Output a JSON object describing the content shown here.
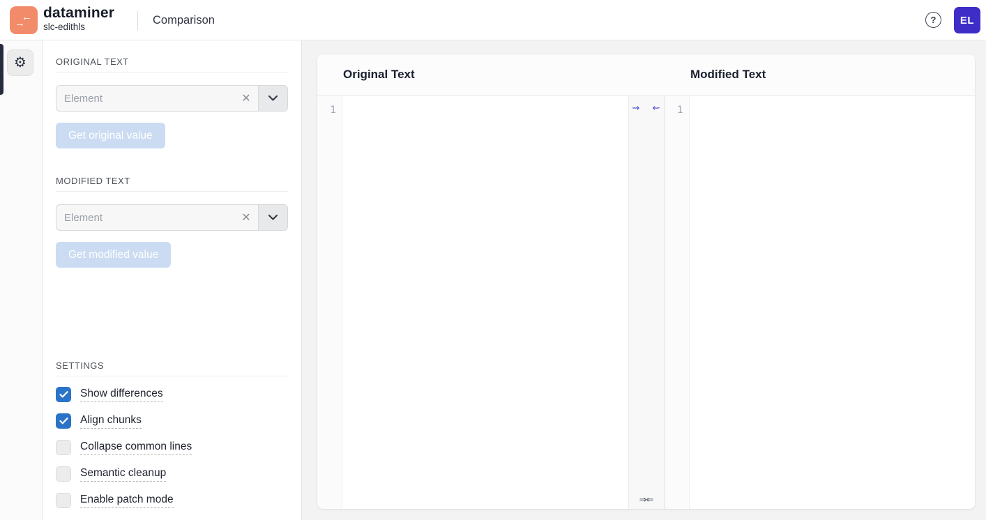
{
  "header": {
    "app_name": "dataminer",
    "app_subtitle": "slc-edithls",
    "page_title": "Comparison",
    "help_label": "?",
    "user_initials": "EL"
  },
  "icons": {
    "logo_arrow_right": "→",
    "logo_arrow_left": "←",
    "gear": "⚙",
    "clear": "✕",
    "copy_right_wavy": "⇝",
    "copy_left_wavy": "⇜",
    "align_arrows": "⇒⇐"
  },
  "colors": {
    "logo_bg": "#F28B69",
    "avatar_bg": "#3F2DC8",
    "checkbox_checked": "#2B73C8",
    "disabled_button_bg": "#CBDCF2",
    "merge_arrow": "#5251CF",
    "page_bg": "#F3F3F4"
  },
  "sidebar": {
    "original_section": {
      "title": "ORIGINAL TEXT",
      "input_value": "",
      "input_placeholder": "Element",
      "button_label": "Get original value"
    },
    "modified_section": {
      "title": "MODIFIED TEXT",
      "input_value": "",
      "input_placeholder": "Element",
      "button_label": "Get modified value"
    },
    "settings": {
      "title": "SETTINGS",
      "options": [
        {
          "label": "Show differences",
          "checked": true
        },
        {
          "label": "Align chunks",
          "checked": true
        },
        {
          "label": "Collapse common lines",
          "checked": false
        },
        {
          "label": "Semantic cleanup",
          "checked": false
        },
        {
          "label": "Enable patch mode",
          "checked": false
        }
      ]
    }
  },
  "comparison": {
    "left_pane": {
      "title": "Original Text",
      "line_number": "1",
      "content": ""
    },
    "right_pane": {
      "title": "Modified Text",
      "line_number": "1",
      "content": ""
    }
  }
}
